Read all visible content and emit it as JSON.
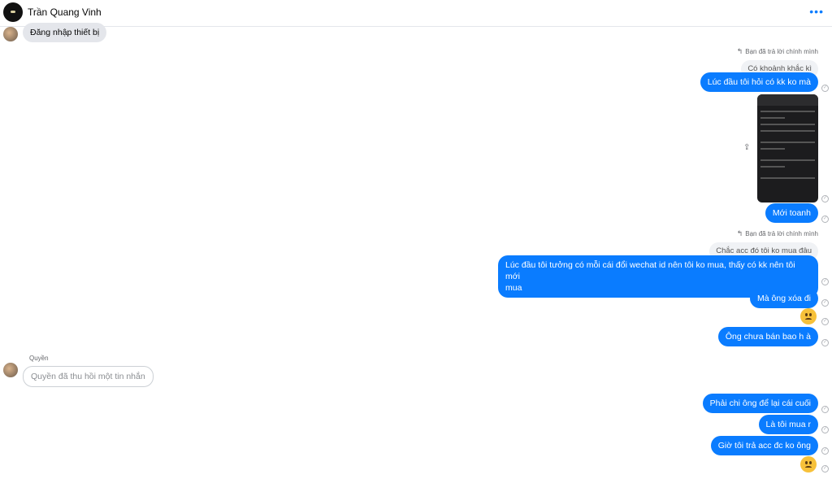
{
  "header": {
    "contact_name": "Trần Quang Vinh",
    "more_icon": "more-dots-icon"
  },
  "messages": {
    "m_in1": "Đăng nhập thiết bị",
    "reply_hint1": "Bạn đã trả lời chính mình",
    "quote1": "Có khoảnh khắc kì",
    "m_out1": "Lúc đầu tôi hỏi có kk ko mà",
    "m_out2": "Mới toanh",
    "reply_hint2": "Bạn đã trả lời chính mình",
    "quote2": "Chắc acc đó tôi ko mua đâu",
    "m_out3_line1": "Lúc đầu tôi tưởng có mỗi cái đổi wechat id nên tôi ko mua, thấy có kk nên tôi mới",
    "m_out3_line2": "mua",
    "m_out4": "Mà ông xóa đi",
    "m_out5": "Ông chưa bán bao h à",
    "sender": "Quyền",
    "unsent": "Quyền đã thu hồi một tin nhắn",
    "m_out6": "Phải chi ông để lại cái cuối",
    "m_out7": "Là tôi mua r",
    "m_out8": "Giờ tôi trả acc đc ko ông"
  },
  "colors": {
    "outgoing": "#0a7cff",
    "incoming": "#e4e6eb"
  }
}
